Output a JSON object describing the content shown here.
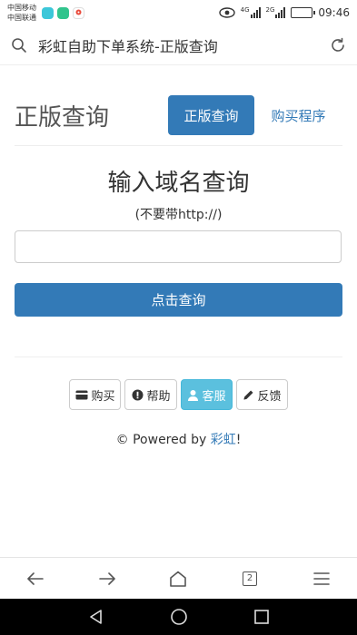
{
  "status_bar": {
    "carrier1": "中国移动",
    "carrier2": "中国联通",
    "net1": "4G",
    "net2": "2G",
    "time": "09:46",
    "app_icon_colors": [
      "#3cc7d9",
      "#31c48d",
      "#ffffff"
    ]
  },
  "address_bar": {
    "title": "彩虹自助下单系统-正版查询",
    "icons": [
      "search-icon",
      "refresh-icon"
    ]
  },
  "header": {
    "title": "正版查询",
    "tab_active": "正版查询",
    "tab_link": "购买程序"
  },
  "query": {
    "title": "输入域名查询",
    "hint": "(不要带http://)",
    "input_value": "",
    "submit": "点击查询"
  },
  "buttons": {
    "buy": "购买",
    "help": "帮助",
    "service": "客服",
    "feedback": "反馈"
  },
  "footer": {
    "prefix": "© Powered by ",
    "link": "彩虹",
    "suffix": "!"
  },
  "browser_bar": {
    "tab_count": "2"
  },
  "colors": {
    "primary": "#337ab7",
    "info": "#5bc0de",
    "nav_bg": "#000000"
  }
}
